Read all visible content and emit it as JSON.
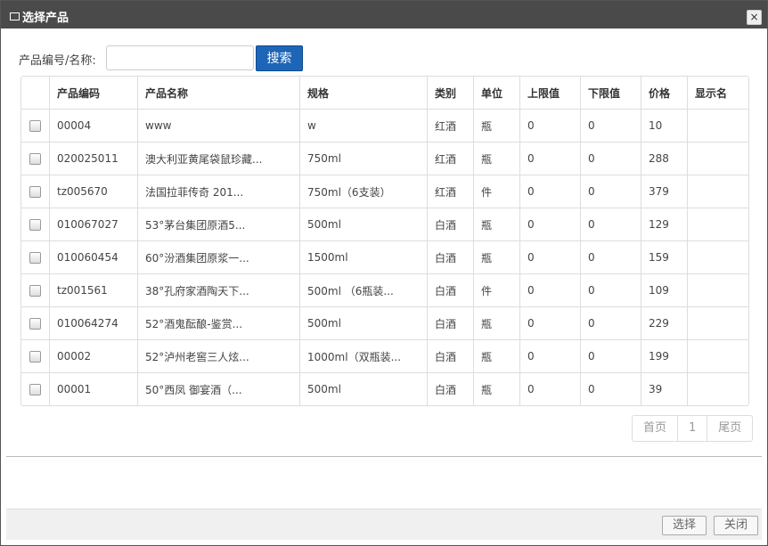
{
  "dialog": {
    "title": "选择产品",
    "close_label": "×"
  },
  "search": {
    "label": "产品编号/名称:",
    "value": "",
    "placeholder": "",
    "button_label": "搜索"
  },
  "table": {
    "headers": [
      "产品编码",
      "产品名称",
      "规格",
      "类别",
      "单位",
      "上限值",
      "下限值",
      "价格",
      "显示名"
    ],
    "rows": [
      {
        "code": "00004",
        "name": "www",
        "spec": "w",
        "category": "红酒",
        "unit": "瓶",
        "upper": "0",
        "lower": "0",
        "price": "10",
        "display": ""
      },
      {
        "code": "020025011",
        "name": "澳大利亚黄尾袋鼠珍藏...",
        "spec": "750ml",
        "category": "红酒",
        "unit": "瓶",
        "upper": "0",
        "lower": "0",
        "price": "288",
        "display": ""
      },
      {
        "code": "tz005670",
        "name": "法国拉菲传奇 201...",
        "spec": "750ml（6支装）",
        "category": "红酒",
        "unit": "件",
        "upper": "0",
        "lower": "0",
        "price": "379",
        "display": ""
      },
      {
        "code": "010067027",
        "name": "53°茅台集团原酒5...",
        "spec": "500ml",
        "category": "白酒",
        "unit": "瓶",
        "upper": "0",
        "lower": "0",
        "price": "129",
        "display": ""
      },
      {
        "code": "010060454",
        "name": "60°汾酒集团原浆一...",
        "spec": "1500ml",
        "category": "白酒",
        "unit": "瓶",
        "upper": "0",
        "lower": "0",
        "price": "159",
        "display": ""
      },
      {
        "code": "tz001561",
        "name": "38°孔府家酒陶天下...",
        "spec": "500ml （6瓶装...",
        "category": "白酒",
        "unit": "件",
        "upper": "0",
        "lower": "0",
        "price": "109",
        "display": ""
      },
      {
        "code": "010064274",
        "name": "52°酒鬼酝酿-鉴赏...",
        "spec": "500ml",
        "category": "白酒",
        "unit": "瓶",
        "upper": "0",
        "lower": "0",
        "price": "229",
        "display": ""
      },
      {
        "code": "00002",
        "name": "52°泸州老窖三人炫...",
        "spec": "1000ml（双瓶装...",
        "category": "白酒",
        "unit": "瓶",
        "upper": "0",
        "lower": "0",
        "price": "199",
        "display": ""
      },
      {
        "code": "00001",
        "name": "50°西凤 御宴酒（...",
        "spec": "500ml",
        "category": "白酒",
        "unit": "瓶",
        "upper": "0",
        "lower": "0",
        "price": "39",
        "display": ""
      }
    ]
  },
  "pager": {
    "first_label": "首页",
    "page": "1",
    "last_label": "尾页"
  },
  "footer": {
    "select_label": "选择",
    "close_label": "关闭"
  }
}
